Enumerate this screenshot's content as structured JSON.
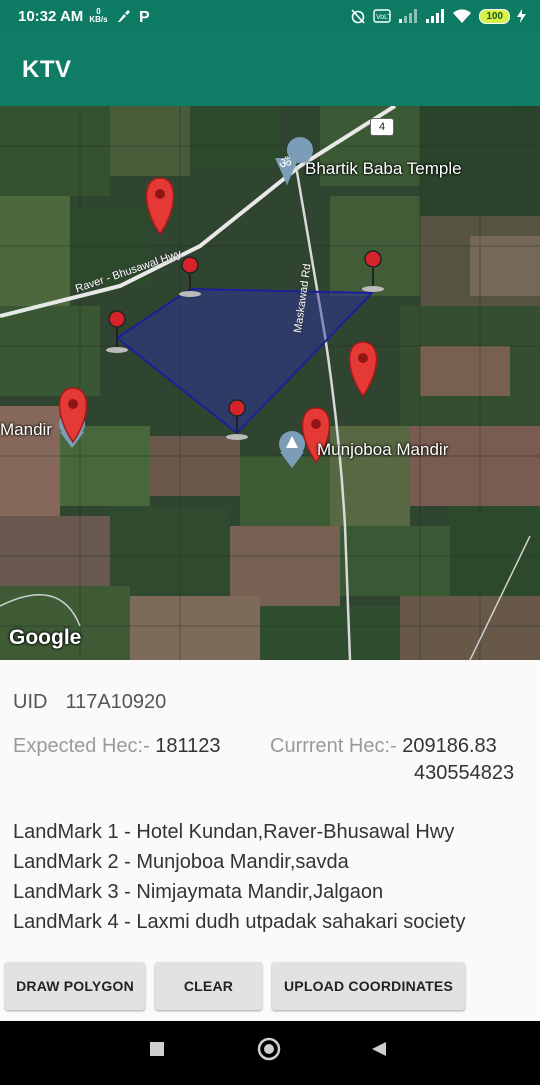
{
  "status_bar": {
    "time": "10:32 AM",
    "net_speed_value": "0",
    "net_speed_unit": "KB/s",
    "battery": "100"
  },
  "app_bar": {
    "title": "KTV"
  },
  "map": {
    "labels": {
      "temple": "Bhartik Baba Temple",
      "mandir_right": "Munjoboa Mandir",
      "mandir_left": "Mandir",
      "road_hwy": "Raver - Bhusawal Hwy",
      "road_maskawad": "Maskawad Rd",
      "road_shield": "4"
    },
    "attribution": "Google",
    "polygon_color": "#2d2fa8"
  },
  "info": {
    "uid_label": "UID",
    "uid_value": "117A10920",
    "expected_label": "Expected Hec:-",
    "expected_value": "181123",
    "current_label": "Currrent Hec:-",
    "current_value_line1": "209186.83",
    "current_value_line2": "430554823",
    "landmarks": [
      "LandMark 1 - Hotel Kundan,Raver-Bhusawal Hwy",
      "LandMark 2 - Munjoboa Mandir,savda",
      "LandMark 3 - Nimjaymata Mandir,Jalgaon",
      "LandMark 4 - Laxmi dudh utpadak sahakari society"
    ]
  },
  "buttons": {
    "draw": "DRAW POLYGON",
    "clear": "CLEAR",
    "upload": "UPLOAD COORDINATES"
  },
  "nav_icons": [
    "recents-icon",
    "home-icon",
    "back-icon"
  ]
}
